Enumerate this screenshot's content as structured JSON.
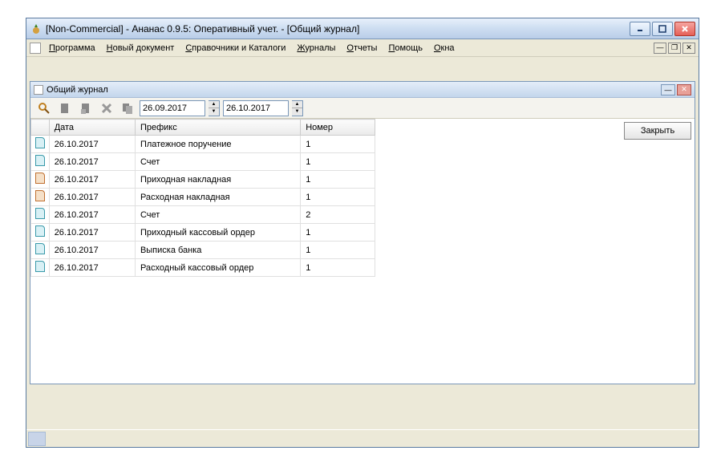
{
  "window": {
    "title": "[Non-Commercial] - Ананас 0.9.5: Оперативный учет. - [Общий журнал]"
  },
  "menu": {
    "program": "Программа",
    "new_doc": "Новый документ",
    "catalogs": "Справочники и Каталоги",
    "journals": "Журналы",
    "reports": "Отчеты",
    "help": "Помощь",
    "windows": "Окна"
  },
  "child": {
    "title": "Общий журнал"
  },
  "toolbar": {
    "date_from": "26.09.2017",
    "date_to": "26.10.2017"
  },
  "table": {
    "col_date": "Дата",
    "col_prefix": "Префикс",
    "col_number": "Номер",
    "rows": [
      {
        "date": "26.10.2017",
        "prefix": "Платежное поручение",
        "number": "1",
        "ic": "blue"
      },
      {
        "date": "26.10.2017",
        "prefix": "Счет",
        "number": "1",
        "ic": "blue"
      },
      {
        "date": "26.10.2017",
        "prefix": "Приходная накладная",
        "number": "1",
        "ic": "orange"
      },
      {
        "date": "26.10.2017",
        "prefix": "Расходная накладная",
        "number": "1",
        "ic": "orange"
      },
      {
        "date": "26.10.2017",
        "prefix": "Счет",
        "number": "2",
        "ic": "blue"
      },
      {
        "date": "26.10.2017",
        "prefix": "Приходный кассовый ордер",
        "number": "1",
        "ic": "blue"
      },
      {
        "date": "26.10.2017",
        "prefix": "Выписка банка",
        "number": "1",
        "ic": "blue"
      },
      {
        "date": "26.10.2017",
        "prefix": "Расходный кассовый ордер",
        "number": "1",
        "ic": "blue"
      }
    ]
  },
  "buttons": {
    "close": "Закрыть"
  }
}
